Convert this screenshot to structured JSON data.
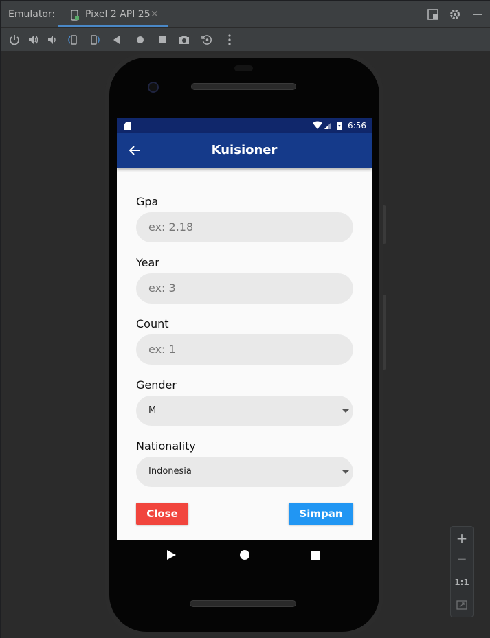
{
  "window": {
    "label": "Emulator:",
    "tab_title": "Pixel 2 API 25",
    "tab_close": "✕"
  },
  "status_bar": {
    "time": "6:56"
  },
  "app_bar": {
    "title": "Kuisioner"
  },
  "form": {
    "gpa": {
      "label": "Gpa",
      "placeholder": "ex: 2.18"
    },
    "year": {
      "label": "Year",
      "placeholder": "ex: 3"
    },
    "count": {
      "label": "Count",
      "placeholder": "ex: 1"
    },
    "gender": {
      "label": "Gender",
      "value": "M"
    },
    "nationality": {
      "label": "Nationality",
      "value": "Indonesia"
    }
  },
  "buttons": {
    "close": "Close",
    "save": "Simpan"
  },
  "zoom": {
    "plus": "+",
    "minus": "−",
    "one_to_one": "1:1"
  },
  "colors": {
    "appbar": "#153a8a",
    "statusbar": "#10276b",
    "close_button": "#f1453d",
    "save_button": "#2196f3"
  }
}
